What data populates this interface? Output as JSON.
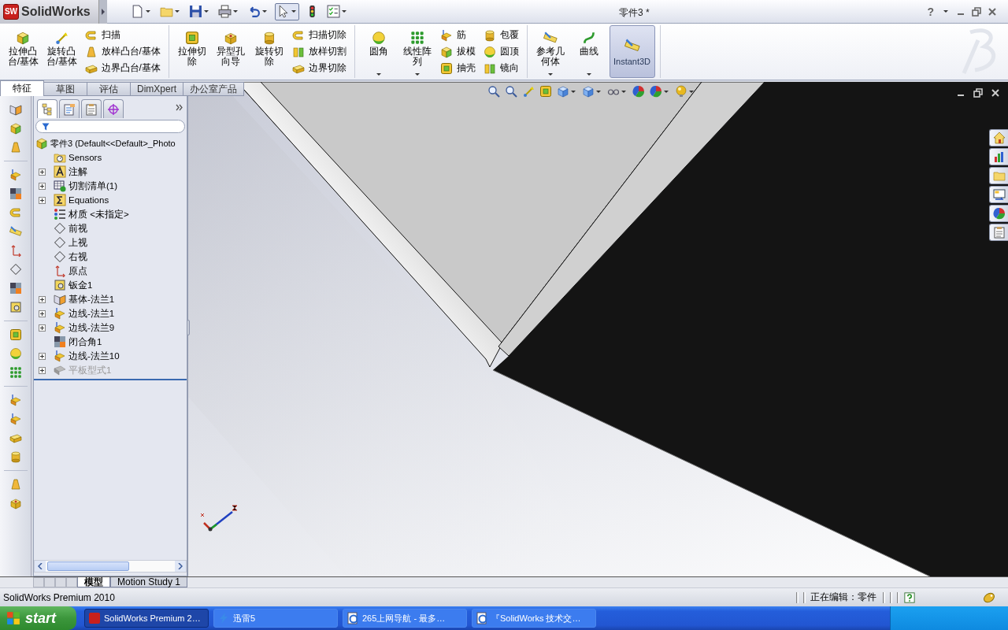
{
  "title_bar": {
    "logo_mark": "SW",
    "logo": "SolidWorks",
    "document_title": "零件3 *",
    "help": "?"
  },
  "ribbon": {
    "groups": [
      {
        "items": [
          {
            "kind": "large",
            "label": "拉伸凸台/基体",
            "menu": false
          },
          {
            "kind": "large",
            "label": "旋转凸台/基体",
            "menu": false
          },
          {
            "kind": "stack",
            "items": [
              {
                "label": "扫描"
              },
              {
                "label": "放样凸台/基体"
              },
              {
                "label": "边界凸台/基体"
              }
            ]
          }
        ]
      },
      {
        "items": [
          {
            "kind": "large",
            "label": "拉伸切除",
            "menu": false
          },
          {
            "kind": "large",
            "label": "异型孔向导",
            "menu": false
          },
          {
            "kind": "large",
            "label": "旋转切除",
            "menu": false
          },
          {
            "kind": "stack",
            "items": [
              {
                "label": "扫描切除"
              },
              {
                "label": "放样切割"
              },
              {
                "label": "边界切除"
              }
            ]
          }
        ]
      },
      {
        "items": [
          {
            "kind": "large",
            "label": "圆角",
            "menu": true
          },
          {
            "kind": "large",
            "label": "线性阵列",
            "menu": true
          },
          {
            "kind": "stack",
            "items": [
              {
                "label": "筋"
              },
              {
                "label": "拔模"
              },
              {
                "label": "抽壳"
              }
            ]
          },
          {
            "kind": "stack",
            "items": [
              {
                "label": "包覆"
              },
              {
                "label": "圆顶"
              },
              {
                "label": "镜向"
              }
            ]
          }
        ]
      },
      {
        "items": [
          {
            "kind": "large",
            "label": "参考几何体",
            "menu": true
          },
          {
            "kind": "large",
            "label": "曲线",
            "menu": true
          },
          {
            "kind": "toggle",
            "label": "Instant3D",
            "on": true
          }
        ]
      }
    ]
  },
  "command_tabs": [
    {
      "label": "特征",
      "selected": true
    },
    {
      "label": "草图",
      "selected": false
    },
    {
      "label": "评估",
      "selected": false
    },
    {
      "label": "DimXpert",
      "selected": false
    },
    {
      "label": "办公室产品",
      "selected": false
    }
  ],
  "feature_tree": {
    "panel_tabs": [
      {
        "selected": true
      },
      {
        "selected": false
      },
      {
        "selected": false
      },
      {
        "selected": false
      }
    ],
    "root": "零件3  (Default<<Default>_Photo",
    "items": [
      {
        "label": "Sensors",
        "kind": "sensors",
        "disabled": false
      },
      {
        "label": "注解",
        "kind": "annotations",
        "expanded": false,
        "disabled": false
      },
      {
        "label": "切割清单(1)",
        "kind": "cutlist",
        "expanded": false,
        "disabled": false
      },
      {
        "label": "Equations",
        "kind": "equations",
        "expanded": false,
        "disabled": false
      },
      {
        "label": "材质 <未指定>",
        "kind": "material",
        "disabled": false
      },
      {
        "label": "前视",
        "kind": "plane",
        "disabled": false
      },
      {
        "label": "上视",
        "kind": "plane",
        "disabled": false
      },
      {
        "label": "右视",
        "kind": "plane",
        "disabled": false
      },
      {
        "label": "原点",
        "kind": "origin",
        "disabled": false
      },
      {
        "label": "钣金1",
        "kind": "sheetmetal",
        "disabled": false
      },
      {
        "label": "基体-法兰1",
        "kind": "base_flange",
        "expanded": false,
        "disabled": false
      },
      {
        "label": "边线-法兰1",
        "kind": "edge_flange",
        "expanded": false,
        "disabled": false
      },
      {
        "label": "边线-法兰9",
        "kind": "edge_flange",
        "expanded": false,
        "disabled": false
      },
      {
        "label": "闭合角1",
        "kind": "corner",
        "disabled": false
      },
      {
        "label": "边线-法兰10",
        "kind": "edge_flange",
        "expanded": false,
        "disabled": false
      },
      {
        "label": "平板型式1",
        "kind": "flat",
        "expanded": false,
        "disabled": true
      }
    ]
  },
  "bottom_tabs": [
    {
      "label": "模型",
      "selected": true
    },
    {
      "label": "Motion Study 1",
      "selected": false
    }
  ],
  "status_bar": {
    "product": "SolidWorks Premium 2010",
    "mode": "正在编辑：零件"
  },
  "taskbar": {
    "start": "start",
    "tasks": [
      {
        "label": "SolidWorks Premium 2…",
        "kind": "app",
        "selected": true
      },
      {
        "label": "迅雷5",
        "kind": "download",
        "selected": false
      },
      {
        "label": "265上网导航 - 最多…",
        "kind": "browser",
        "selected": false
      },
      {
        "label": "『SolidWorks 技术交…",
        "kind": "browser",
        "selected": false
      }
    ]
  }
}
